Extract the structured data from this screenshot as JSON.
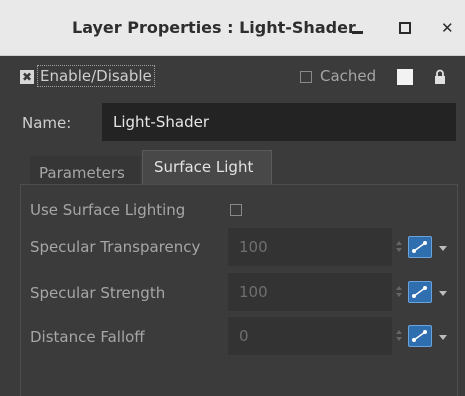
{
  "window": {
    "title": "Layer Properties : Light-Shader"
  },
  "header": {
    "enable_label": "Enable/Disable",
    "enable_checked": true,
    "cached_label": "Cached",
    "cached_checked": false,
    "swatch_color": "#f2f2f2"
  },
  "name": {
    "label": "Name:",
    "value": "Light-Shader"
  },
  "tabs": [
    {
      "label": "Parameters",
      "active": false
    },
    {
      "label": "Surface Light",
      "active": true
    }
  ],
  "surface_light": {
    "use_surface_lighting": {
      "label": "Use Surface Lighting",
      "checked": false
    },
    "fields": [
      {
        "label": "Specular Transparency",
        "value": "100"
      },
      {
        "label": "Specular Strength",
        "value": "100"
      },
      {
        "label": "Distance Falloff",
        "value": "0"
      }
    ]
  },
  "colors": {
    "curve_button": "#2f6fb0",
    "panel_bg": "#3b3b3b",
    "titlebar_bg": "#e9e9e9"
  }
}
